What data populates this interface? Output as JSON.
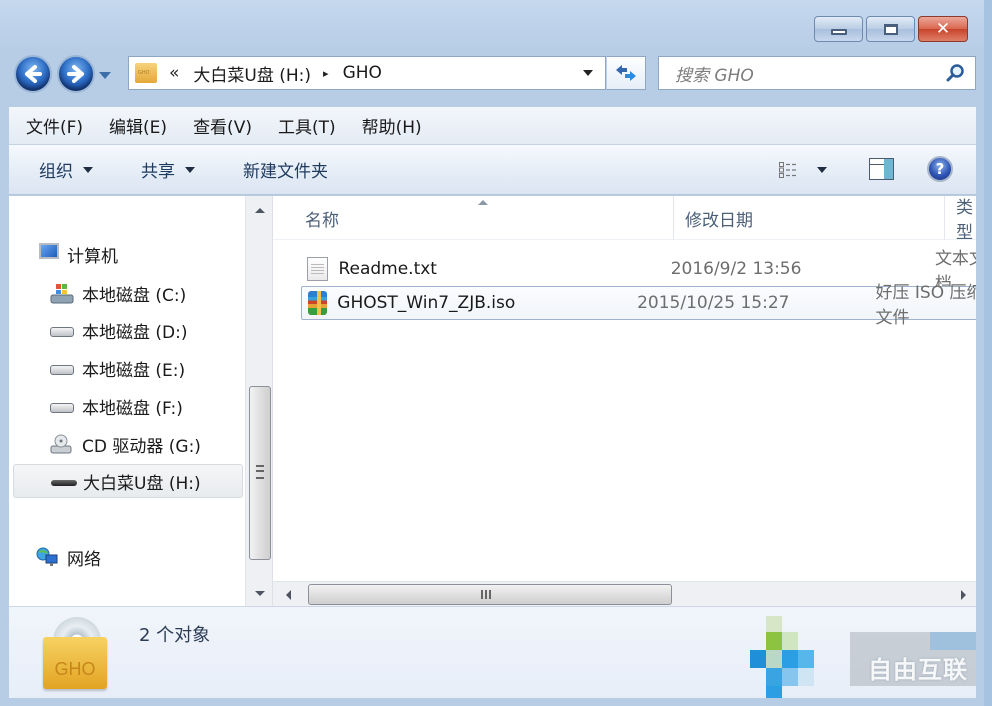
{
  "window": {
    "caption_buttons": {
      "minimize_icon": "minimize-icon",
      "maximize_icon": "maximize-icon",
      "close_icon": "close-icon",
      "close_glyph": "✕"
    }
  },
  "navigation": {
    "back_glyph": "🡐",
    "forward_glyph": "🡒",
    "address": {
      "overflow_glyph": "«",
      "breadcrumbs": [
        "大白菜U盘 (H:)",
        "GHO"
      ],
      "separator_glyph": "▸"
    },
    "refresh_glyph": "⇆",
    "search": {
      "placeholder": "搜索 GHO"
    }
  },
  "menubar": {
    "items": [
      "文件(F)",
      "编辑(E)",
      "查看(V)",
      "工具(T)",
      "帮助(H)"
    ]
  },
  "commandbar": {
    "organize": "组织",
    "share": "共享",
    "new_folder": "新建文件夹",
    "help_glyph": "?"
  },
  "navpane": {
    "computer": "计算机",
    "drives": [
      {
        "label": "本地磁盘 (C:)",
        "icon": "system-drive-icon"
      },
      {
        "label": "本地磁盘 (D:)",
        "icon": "hard-drive-icon"
      },
      {
        "label": "本地磁盘 (E:)",
        "icon": "hard-drive-icon"
      },
      {
        "label": "本地磁盘 (F:)",
        "icon": "hard-drive-icon"
      },
      {
        "label": "CD 驱动器 (G:)",
        "icon": "cd-drive-icon"
      },
      {
        "label": "大白菜U盘 (H:)",
        "icon": "usb-drive-icon",
        "selected": true
      }
    ],
    "network": "网络"
  },
  "filelist": {
    "columns": [
      "名称",
      "修改日期",
      "类型"
    ],
    "files": [
      {
        "name": "Readme.txt",
        "modified": "2016/9/2 13:56",
        "type": "文本文档",
        "icon": "text-file-icon"
      },
      {
        "name": "GHOST_Win7_ZJB.iso",
        "modified": "2015/10/25 15:27",
        "type": "好压 ISO 压缩文件",
        "icon": "iso-archive-icon",
        "focused": true
      }
    ],
    "hscroll_grip": "III"
  },
  "details": {
    "folder_label": "GHO",
    "item_count": "2 个对象"
  },
  "watermark": {
    "text": "自由互联"
  }
}
